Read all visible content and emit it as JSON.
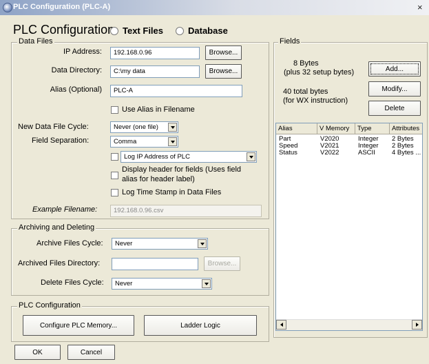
{
  "window": {
    "title": "PLC Configuration (PLC-A)",
    "close_glyph": "×"
  },
  "header": {
    "title": "PLC Configuration",
    "radio_text_files": "Text Files",
    "radio_database": "Database"
  },
  "data_files": {
    "legend": "Data Files",
    "ip_label": "IP Address:",
    "ip_value": "192.168.0.96",
    "browse1": "Browse...",
    "dir_label": "Data Directory:",
    "dir_value": "C:\\my data",
    "browse2": "Browse...",
    "alias_label": "Alias (Optional)",
    "alias_value": "PLC-A",
    "use_alias": "Use Alias in Filename",
    "cycle_label": "New Data File Cycle:",
    "cycle_value": "Never (one file)",
    "sep_label": "Field Separation:",
    "sep_value": "Comma",
    "log_ip": "Log IP Address of PLC",
    "header_line1": "Display header for fields (Uses field",
    "header_line2": "alias for header label)",
    "log_time": "Log Time Stamp in Data Files",
    "example_label": "Example Filename:",
    "example_value": "192.168.0.96.csv"
  },
  "archiving": {
    "legend": "Archiving and Deleting",
    "archive_cycle_label": "Archive Files Cycle:",
    "archive_cycle_value": "Never",
    "archived_dir_label": "Archived Files Directory:",
    "archived_dir_value": "",
    "browse": "Browse...",
    "delete_cycle_label": "Delete Files Cycle:",
    "delete_cycle_value": "Never"
  },
  "plc_config": {
    "legend": "PLC Configuration",
    "configure_memory": "Configure PLC Memory...",
    "ladder_logic": "Ladder Logic"
  },
  "fields": {
    "legend": "Fields",
    "bytes": "8 Bytes",
    "setup_bytes": "(plus 32 setup bytes)",
    "total_bytes": "40 total bytes",
    "wx": "(for WX instruction)",
    "add": "Add...",
    "modify": "Modify...",
    "delete": "Delete",
    "columns": [
      "Alias",
      "V Memory",
      "Type",
      "Attributes"
    ],
    "rows": [
      [
        "Part",
        "V2020",
        "Integer",
        "2 Bytes"
      ],
      [
        "Speed",
        "V2021",
        "Integer",
        "2 Bytes"
      ],
      [
        "Status",
        "V2022",
        "ASCII",
        "4 Bytes ..."
      ]
    ]
  },
  "footer": {
    "ok": "OK",
    "cancel": "Cancel"
  }
}
